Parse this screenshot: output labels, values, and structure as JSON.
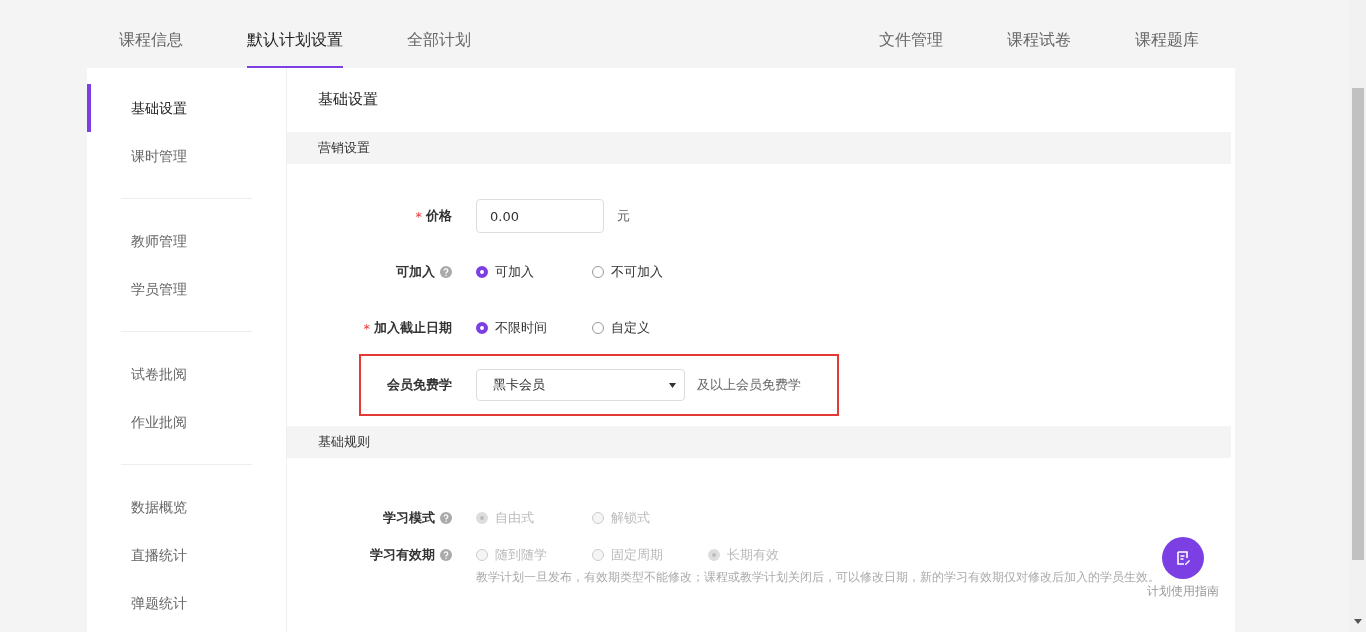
{
  "tabs": [
    {
      "label": "课程信息",
      "selected": false
    },
    {
      "label": "默认计划设置",
      "selected": true
    },
    {
      "label": "全部计划",
      "selected": false
    }
  ],
  "right_tabs": [
    "文件管理",
    "课程试卷",
    "课程题库"
  ],
  "sidebar": {
    "groups": [
      {
        "items": [
          {
            "label": "基础设置",
            "selected": true
          },
          {
            "label": "课时管理",
            "selected": false
          }
        ]
      },
      {
        "items": [
          {
            "label": "教师管理",
            "selected": false
          },
          {
            "label": "学员管理",
            "selected": false
          }
        ]
      },
      {
        "items": [
          {
            "label": "试卷批阅",
            "selected": false
          },
          {
            "label": "作业批阅",
            "selected": false
          }
        ]
      },
      {
        "items": [
          {
            "label": "数据概览",
            "selected": false
          },
          {
            "label": "直播统计",
            "selected": false
          },
          {
            "label": "弹题统计",
            "selected": false
          }
        ]
      }
    ]
  },
  "panel_title": "基础设置",
  "sections": [
    {
      "title": "营销设置",
      "rows": [
        {
          "kind": "input",
          "label": "价格",
          "required_mark": "*",
          "help": false,
          "highlighted": false,
          "value": "0.00",
          "suffix": "元"
        },
        {
          "kind": "radio",
          "label": "可加入",
          "help": true,
          "highlighted": false,
          "disabled": false,
          "options": [
            {
              "label": "可加入",
              "selected": true
            },
            {
              "label": "不可加入",
              "selected": false
            }
          ]
        },
        {
          "kind": "radio",
          "label": "加入截止日期",
          "required_mark": "*",
          "help": false,
          "highlighted": false,
          "disabled": false,
          "options": [
            {
              "label": "不限时间",
              "selected": true
            },
            {
              "label": "自定义",
              "selected": false
            }
          ]
        },
        {
          "kind": "select",
          "label": "会员免费学",
          "help": false,
          "highlighted": true,
          "value": "黑卡会员",
          "suffix": "及以上会员免费学"
        }
      ]
    },
    {
      "title": "基础规则",
      "rows": [
        {
          "kind": "radio",
          "label": "学习模式",
          "help": true,
          "highlighted": false,
          "disabled": true,
          "options": [
            {
              "label": "自由式",
              "selected": true
            },
            {
              "label": "解锁式",
              "selected": false
            }
          ]
        },
        {
          "kind": "radio",
          "label": "学习有效期",
          "help": true,
          "highlighted": false,
          "disabled": true,
          "options": [
            {
              "label": "随到随学",
              "selected": false
            },
            {
              "label": "固定周期",
              "selected": false
            },
            {
              "label": "长期有效",
              "selected": true
            }
          ],
          "note": "教学计划一旦发布，有效期类型不能修改；课程或教学计划关闭后，可以修改日期，新的学习有效期仅对修改后加入的学员生效。"
        }
      ]
    }
  ],
  "guide_button": {
    "label": "计划使用指南"
  }
}
